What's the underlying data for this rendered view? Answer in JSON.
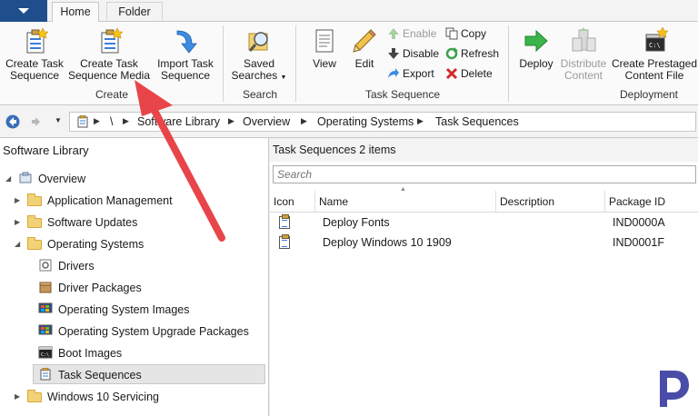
{
  "tabs": [
    {
      "label": "Home",
      "active": true
    },
    {
      "label": "Folder",
      "active": false
    }
  ],
  "ribbon": {
    "create_group": {
      "label": "Create",
      "buttons": [
        {
          "label_line1": "Create Task",
          "label_line2": "Sequence",
          "icon": "task-sequence-icon"
        },
        {
          "label_line1": "Create Task",
          "label_line2": "Sequence Media",
          "icon": "task-sequence-media-icon"
        },
        {
          "label_line1": "Import Task",
          "label_line2": "Sequence",
          "icon": "import-arrow-icon"
        }
      ]
    },
    "search_group": {
      "label": "Search",
      "buttons": [
        {
          "label_line1": "Saved",
          "label_line2": "Searches",
          "icon": "saved-searches-icon",
          "has_dropdown": true
        }
      ]
    },
    "task_sequence_group": {
      "label": "Task Sequence",
      "large_buttons": [
        {
          "label": "View",
          "icon": "view-icon"
        },
        {
          "label": "Edit",
          "icon": "pencil-icon"
        }
      ],
      "small_buttons": [
        {
          "label": "Enable",
          "icon": "enable-icon",
          "disabled": true
        },
        {
          "label": "Disable",
          "icon": "disable-icon",
          "disabled": false
        },
        {
          "label": "Export",
          "icon": "export-icon",
          "disabled": false
        },
        {
          "label": "Copy",
          "icon": "copy-icon",
          "disabled": false
        },
        {
          "label": "Refresh",
          "icon": "refresh-icon",
          "disabled": false
        },
        {
          "label": "Delete",
          "icon": "delete-icon",
          "disabled": false
        }
      ]
    },
    "deployment_group": {
      "label": "Deployment",
      "buttons": [
        {
          "label_line1": "Deploy",
          "label_line2": "",
          "icon": "deploy-arrow-icon",
          "disabled": false
        },
        {
          "label_line1": "Distribute",
          "label_line2": "Content",
          "icon": "distribute-content-icon",
          "disabled": true
        },
        {
          "label_line1": "Create Prestaged",
          "label_line2": "Content File",
          "icon": "prestaged-content-icon",
          "disabled": false
        }
      ]
    }
  },
  "address_bar": {
    "root": "\\",
    "breadcrumbs": [
      "Software Library",
      "Overview",
      "Operating Systems",
      "Task Sequences"
    ]
  },
  "navigation": {
    "title": "Software Library",
    "items": [
      {
        "label": "Overview",
        "icon": "overview-icon",
        "expanded": true
      },
      {
        "label": "Application Management",
        "icon": "folder-icon",
        "expanded": false
      },
      {
        "label": "Software Updates",
        "icon": "folder-icon",
        "expanded": false
      },
      {
        "label": "Operating Systems",
        "icon": "folder-icon",
        "expanded": true
      },
      {
        "label": "Drivers",
        "icon": "drivers-icon"
      },
      {
        "label": "Driver Packages",
        "icon": "driver-packages-icon"
      },
      {
        "label": "Operating System Images",
        "icon": "os-images-icon"
      },
      {
        "label": "Operating System Upgrade Packages",
        "icon": "os-upgrade-packages-icon"
      },
      {
        "label": "Boot Images",
        "icon": "boot-images-icon"
      },
      {
        "label": "Task Sequences",
        "icon": "task-sequence-icon",
        "selected": true
      },
      {
        "label": "Windows 10 Servicing",
        "icon": "folder-icon",
        "expanded": false
      }
    ]
  },
  "results": {
    "header": "Task Sequences 2 items",
    "search_placeholder": "Search",
    "columns": [
      "Icon",
      "Name",
      "Description",
      "Package ID"
    ],
    "rows": [
      {
        "name": "Deploy Fonts",
        "description": "",
        "package_id": "IND0000A"
      },
      {
        "name": "Deploy Windows 10 1909",
        "description": "",
        "package_id": "IND0001F"
      }
    ]
  },
  "colors": {
    "app_button": "#1f4e8c",
    "annotation_arrow": "#e8454a",
    "logo": "#4a4da8"
  }
}
